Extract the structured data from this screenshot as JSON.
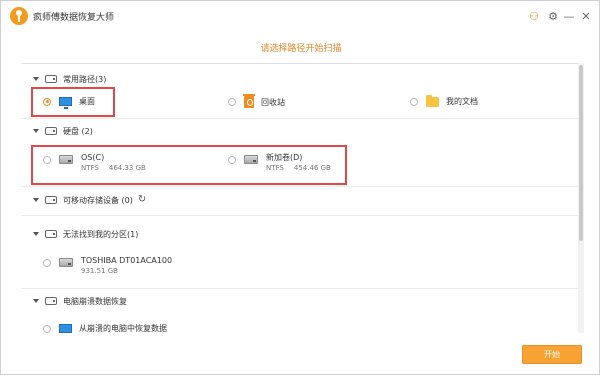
{
  "titlebar": {
    "app_title": "疯师傅数据恢复大师",
    "icons": [
      "user-icon",
      "settings-icon",
      "minimize-icon",
      "close-icon"
    ],
    "glyphs": {
      "user": "⚇",
      "settings": "⚙",
      "minimize": "—",
      "close": "✕"
    }
  },
  "subtitle": "请选择路径开始扫描",
  "sections": {
    "common_paths": {
      "title": "常用路径(3)",
      "items": [
        {
          "label": "桌面",
          "icon": "desktop-icon",
          "selected": true
        },
        {
          "label": "回收站",
          "icon": "recycle-bin-icon",
          "selected": false
        },
        {
          "label": "我的文档",
          "icon": "folder-icon",
          "selected": false
        }
      ]
    },
    "disks": {
      "title": "硬盘 (2)",
      "drives": [
        {
          "name": "OS(C)",
          "fs": "NTFS",
          "size": "464.33 GB"
        },
        {
          "name": "新加卷(D)",
          "fs": "NTFS",
          "size": "454.46 GB"
        }
      ]
    },
    "removable": {
      "title": "可移动存储设备 (0)",
      "refresh_glyph": "↻"
    },
    "lost_partitions": {
      "title": "无法找到我的分区(1)",
      "drives": [
        {
          "name": "TOSHIBA DT01ACA100",
          "size": "931.51 GB"
        }
      ]
    },
    "crash_recovery": {
      "title": "电脑崩溃数据恢复",
      "items": [
        {
          "label": "从崩溃的电脑中恢复数据",
          "icon": "monitor-icon"
        }
      ]
    }
  },
  "footer": {
    "start_label": "开始"
  },
  "colors": {
    "accent": "#f7a233",
    "highlight": "#e24848",
    "subtitle": "#e8872a"
  }
}
